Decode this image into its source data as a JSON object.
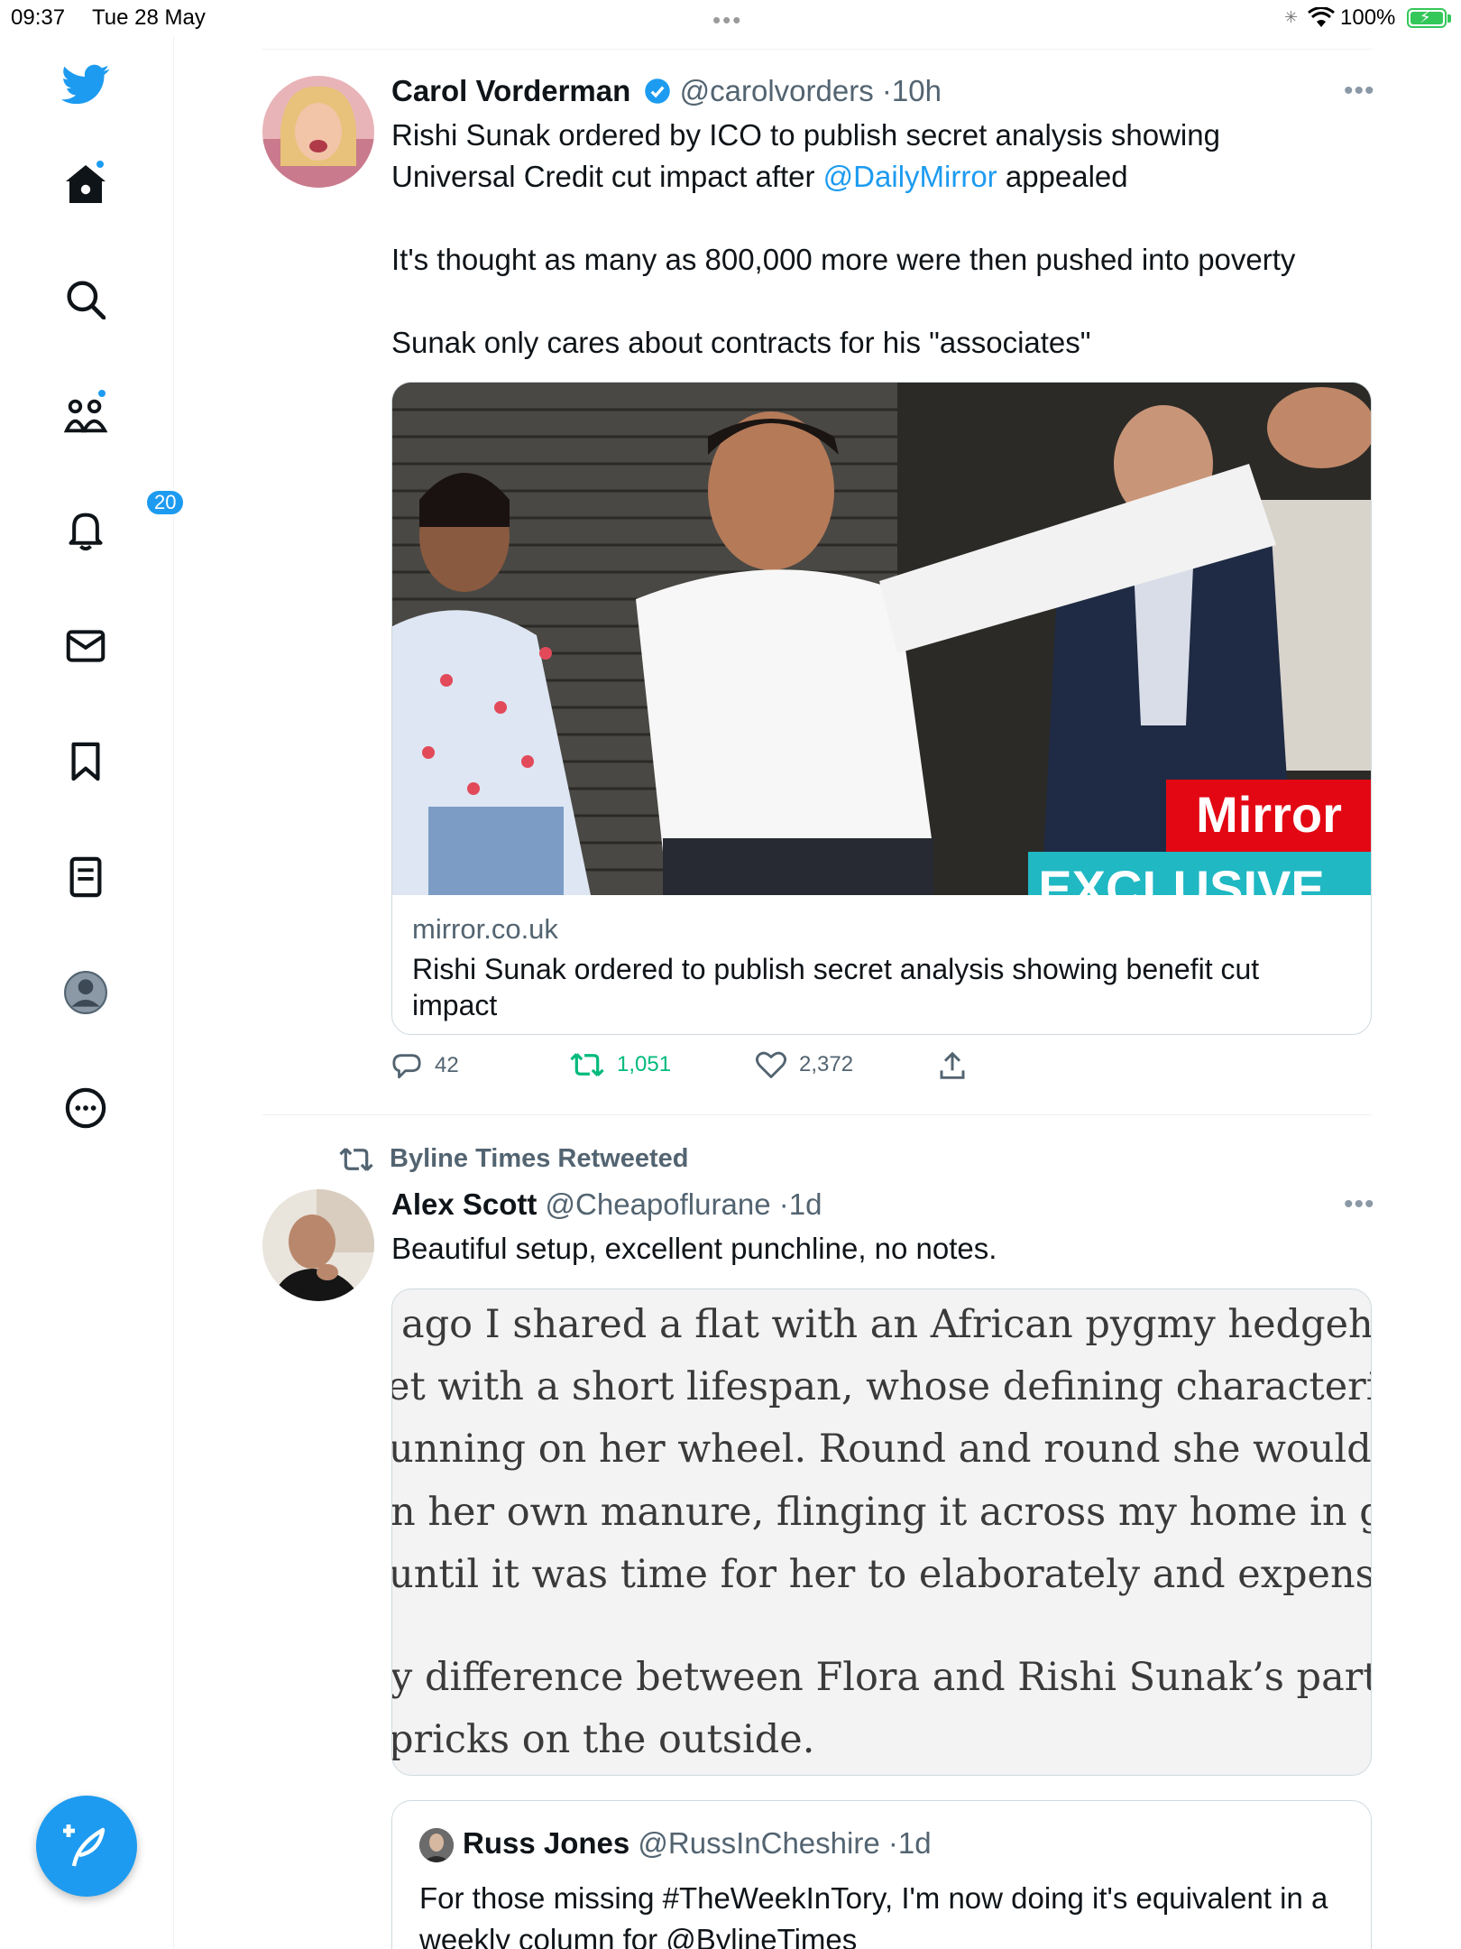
{
  "status_bar": {
    "time": "09:37",
    "date": "Tue 28 May",
    "battery": "100%"
  },
  "sidebar": {
    "items": [
      {
        "name": "home",
        "icon": "home-icon"
      },
      {
        "name": "explore",
        "icon": "search-icon"
      },
      {
        "name": "communities",
        "icon": "communities-icon"
      },
      {
        "name": "notifications",
        "icon": "bell-icon",
        "badge": "20"
      },
      {
        "name": "messages",
        "icon": "mail-icon"
      },
      {
        "name": "bookmarks",
        "icon": "bookmark-icon"
      },
      {
        "name": "lists",
        "icon": "list-icon"
      },
      {
        "name": "profile",
        "icon": "profile-icon"
      },
      {
        "name": "more",
        "icon": "more-circle-icon"
      }
    ],
    "compose_icon": "compose-icon"
  },
  "tweet1": {
    "name": "Carol Vorderman",
    "handle": "@carolvorders",
    "time": "10h",
    "text_line1": "Rishi Sunak ordered by ICO to publish secret analysis showing",
    "text_line2_a": "Universal Credit cut impact after ",
    "text_line2_link": "@DailyMirror",
    "text_line2_b": " appealed",
    "text_p2": "It's thought as many as 800,000 more were then pushed into poverty",
    "text_p3": "Sunak only cares about contracts for his \"associates\"",
    "card": {
      "badge_brand": "Mirror",
      "badge_label": "EXCLUSIVE",
      "domain": "mirror.co.uk",
      "title": "Rishi Sunak ordered to publish secret analysis showing benefit cut impact"
    },
    "replies": "42",
    "retweets": "1,051",
    "likes": "2,372"
  },
  "tweet2": {
    "retweeted_by": "Byline Times Retweeted",
    "name": "Alex Scott",
    "handle": "@Cheapoflurane",
    "time": "1d",
    "text": "Beautiful setup, excellent punchline, no notes.",
    "image_lines": [
      "ago I shared a flat with an African pygmy hedgehog nam",
      "et with a short lifespan, whose defining characteristic was",
      "unning on her wheel. Round and round she would go, gett",
      "n her own manure, flinging it across my home in great sti",
      "until it was time for her to elaborately and expensively die",
      "y difference between Flora and Rishi Sunak’s party is that",
      "pricks on the outside."
    ],
    "quoted": {
      "name": "Russ Jones",
      "handle": "@RussInCheshire",
      "time": "1d",
      "text": "For those missing #TheWeekInTory, I'm now doing it's equivalent in a weekly column for @BylineTimes"
    }
  },
  "colors": {
    "accent": "#1d9bf0",
    "retweet_green": "#00ba7c",
    "text": "#0f1419",
    "muted": "#536471"
  }
}
